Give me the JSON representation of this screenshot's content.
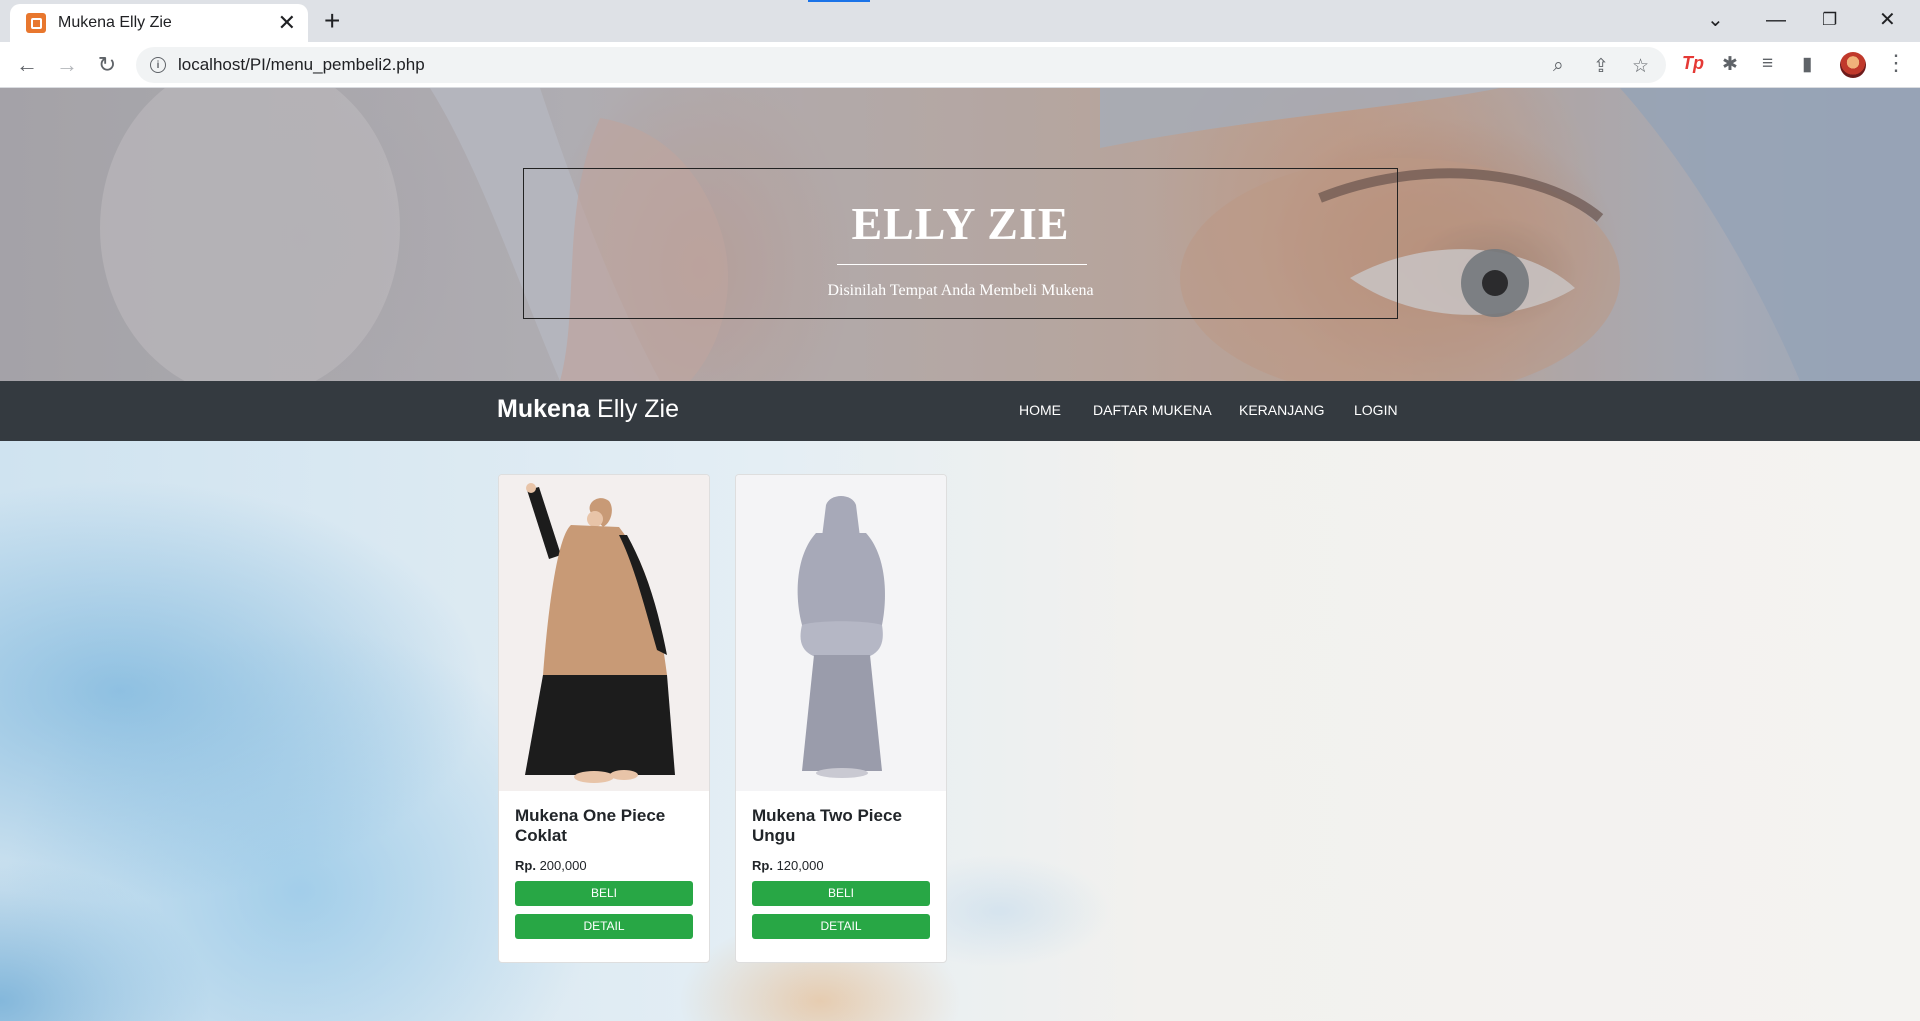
{
  "browser": {
    "tab_title": "Mukena Elly Zie",
    "url": "localhost/PI/menu_pembeli2.php",
    "new_tab": "+",
    "tab_close": "✕"
  },
  "hero": {
    "title": "ELLY ZIE",
    "subtitle": "Disinilah Tempat Anda Membeli Mukena"
  },
  "navbar": {
    "brand_bold": "Mukena",
    "brand_rest": " Elly Zie",
    "links": [
      "HOME",
      "DAFTAR MUKENA",
      "KERANJANG",
      "LOGIN"
    ]
  },
  "products": [
    {
      "name": "Mukena One Piece Coklat",
      "price_label": "Rp.",
      "price": " 200,000",
      "buy_label": "BELI",
      "detail_label": "DETAIL",
      "image_colors": {
        "robe": "#c89a76",
        "skirt": "#1c1c1c",
        "bg": "#f3efee"
      }
    },
    {
      "name": "Mukena Two Piece Ungu",
      "price_label": "Rp.",
      "price": " 120,000",
      "buy_label": "BELI",
      "detail_label": "DETAIL",
      "image_colors": {
        "robe": "#a7a9b8",
        "skirt": "#9a9cab",
        "bg": "#f4f4f6"
      }
    }
  ],
  "colors": {
    "navbar_bg": "#343a40",
    "button_green": "#28a745"
  }
}
